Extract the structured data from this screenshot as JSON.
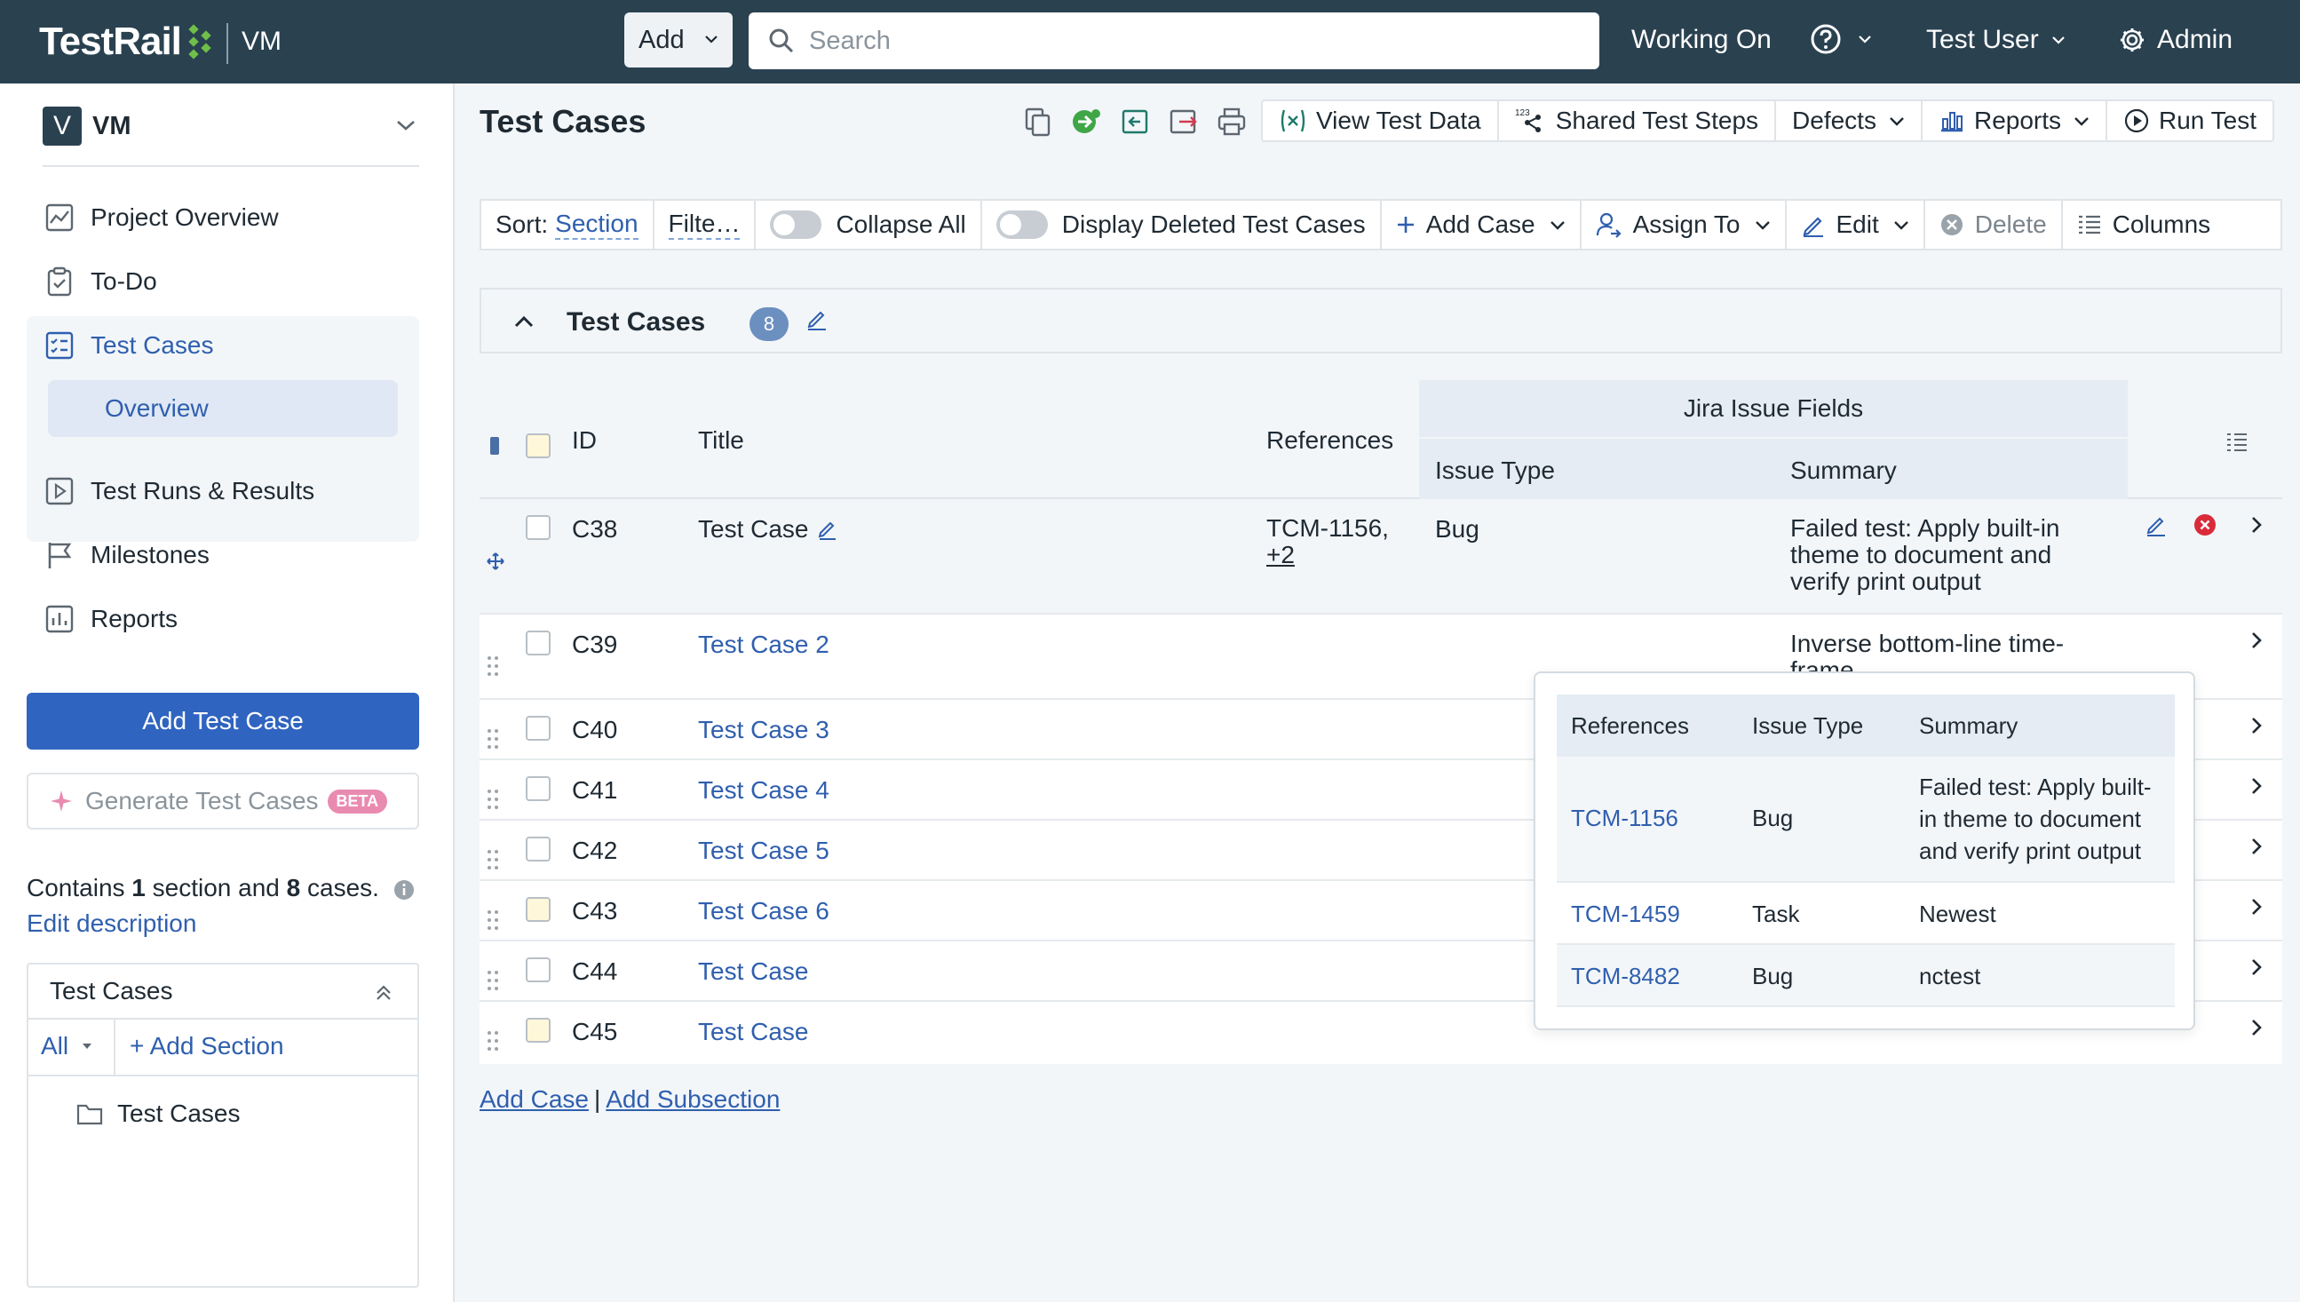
{
  "topbar": {
    "logo": "TestRail",
    "project": "VM",
    "add_label": "Add",
    "search_placeholder": "Search",
    "working_on": "Working On",
    "user": "Test User",
    "admin": "Admin"
  },
  "sidebar": {
    "project_badge": "V",
    "project_name": "VM",
    "nav": {
      "overview": "Project Overview",
      "todo": "To-Do",
      "test_cases": "Test Cases",
      "test_cases_overview": "Overview",
      "runs": "Test Runs & Results",
      "milestones": "Milestones",
      "reports": "Reports"
    },
    "add_test_case": "Add Test Case",
    "generate": "Generate Test Cases",
    "beta": "BETA",
    "contains_prefix": "Contains",
    "sections_count": "1",
    "section_word": "section and",
    "cases_count": "8",
    "cases_word": "cases.",
    "edit_description": "Edit description",
    "sections_box": {
      "title": "Test Cases",
      "filter": "All",
      "add_section": "+ Add Section",
      "tree_item": "Test Cases"
    }
  },
  "main": {
    "title": "Test Cases",
    "buttons": {
      "view_test_data": "View Test Data",
      "shared_steps": "Shared Test Steps",
      "defects": "Defects",
      "reports": "Reports",
      "run_test": "Run Test"
    },
    "toolbar": {
      "sort_label": "Sort:",
      "sort_value": "Section",
      "filter": "Filte…",
      "collapse_all": "Collapse All",
      "display_deleted": "Display Deleted Test Cases",
      "add_case": "Add Case",
      "assign_to": "Assign To",
      "edit": "Edit",
      "delete": "Delete",
      "columns": "Columns"
    },
    "section": {
      "title": "Test Cases",
      "count": "8"
    },
    "table": {
      "headers": {
        "id": "ID",
        "title": "Title",
        "references": "References",
        "jira_group": "Jira Issue Fields",
        "issue_type": "Issue Type",
        "summary": "Summary"
      },
      "rows": [
        {
          "id": "C38",
          "title": "Test Case",
          "refs": "TCM-1156,",
          "refs_more": "+2",
          "issue_type": "Bug",
          "summary": [
            "Failed test: Apply built-in",
            "theme to document and",
            "verify print output"
          ]
        },
        {
          "id": "C39",
          "title": "Test Case 2",
          "summary": [
            "Inverse bottom-line time-",
            "frame"
          ]
        },
        {
          "id": "C40",
          "title": "Test Case 3"
        },
        {
          "id": "C41",
          "title": "Test Case 4"
        },
        {
          "id": "C42",
          "title": "Test Case 5"
        },
        {
          "id": "C43",
          "title": "Test Case 6"
        },
        {
          "id": "C44",
          "title": "Test Case"
        },
        {
          "id": "C45",
          "title": "Test Case"
        }
      ]
    },
    "footer": {
      "add_case": "Add Case",
      "separator": "|",
      "add_subsection": "Add Subsection"
    },
    "popover": {
      "headers": {
        "references": "References",
        "issue_type": "Issue Type",
        "summary": "Summary"
      },
      "rows": [
        {
          "ref": "TCM-1156",
          "type": "Bug",
          "summary": [
            "Failed test: Apply built-",
            "in theme to document",
            "and verify print output"
          ]
        },
        {
          "ref": "TCM-1459",
          "type": "Task",
          "summary": [
            "Newest"
          ]
        },
        {
          "ref": "TCM-8482",
          "type": "Bug",
          "summary": [
            "nctest"
          ]
        }
      ]
    }
  },
  "colors": {
    "topbar": "#2a4150",
    "primary": "#2f64c0",
    "link": "#2f5fae",
    "logo_accent": "#6fbf4a"
  }
}
